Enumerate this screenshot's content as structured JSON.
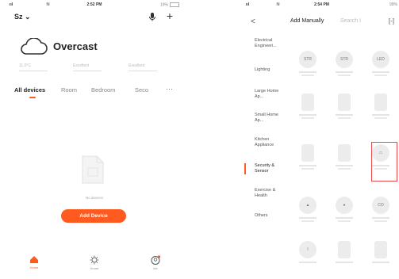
{
  "left_screen": {
    "status": {
      "signal": "ııl",
      "time": "2:52 PM",
      "battery": "19%"
    },
    "home_name": "Sz",
    "weather": {
      "condition": "Overcast",
      "stats": [
        {
          "value": "11.0°C"
        },
        {
          "value": "Excellent"
        },
        {
          "value": "Excellent"
        }
      ]
    },
    "tabs": [
      {
        "label": "All devices"
      },
      {
        "label": "Room"
      },
      {
        "label": "Bedroom"
      },
      {
        "label": "Seco"
      }
    ],
    "more": "···",
    "empty_text": "No devices",
    "add_button": "Add Device",
    "nav": [
      {
        "label": "Home"
      },
      {
        "label": "Smart"
      },
      {
        "label": "Me"
      }
    ],
    "accent": "#ff5a1f"
  },
  "right_screen": {
    "status": {
      "signal": "ııl",
      "time": "2:54 PM",
      "battery": "99%"
    },
    "back": "<",
    "mode_active": "Add Manually",
    "mode_inactive": "Search I",
    "scan": "[-]",
    "categories": [
      {
        "label": "Electrical Engineeri..."
      },
      {
        "label": "Lighting"
      },
      {
        "label": "Large Home Ap..."
      },
      {
        "label": "Small Home Ap..."
      },
      {
        "label": "Kitchen Appliance"
      },
      {
        "label": "Security & Sensor"
      },
      {
        "label": "Exercise & Health"
      },
      {
        "label": "Others"
      }
    ],
    "grid_icons": [
      "STR",
      "STR",
      "LED",
      "CO"
    ],
    "highlight_color": "#e24a4a"
  }
}
